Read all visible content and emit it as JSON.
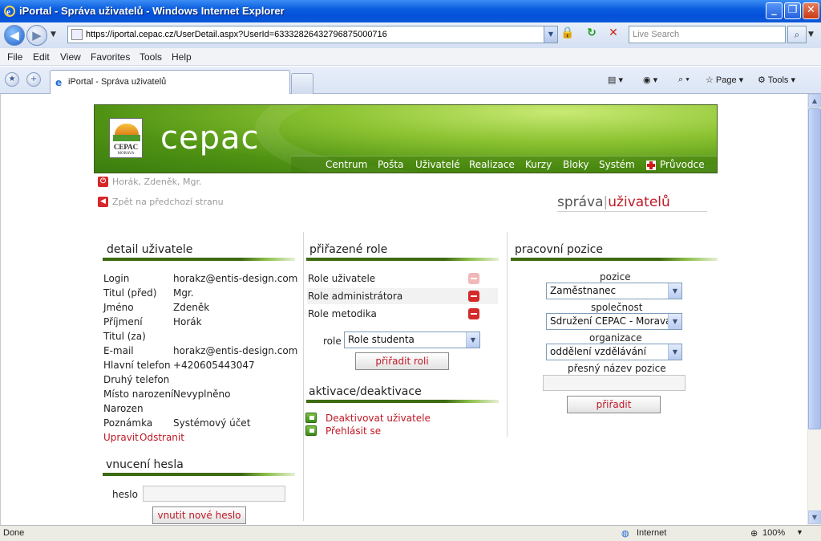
{
  "window": {
    "title": "iPortal - Správa uživatelů - Windows Internet Explorer"
  },
  "address": {
    "url": "https://iportal.cepac.cz/UserDetail.aspx?UserId=633328264327968750​00716",
    "search_placeholder": "Live Search"
  },
  "menu": [
    "File",
    "Edit",
    "View",
    "Favorites",
    "Tools",
    "Help"
  ],
  "tab": {
    "label": "iPortal - Správa uživatelů"
  },
  "commands": {
    "page": "Page",
    "tools": "Tools"
  },
  "status": {
    "text": "Done",
    "zone": "Internet",
    "zoom": "100%"
  },
  "site": {
    "brand": "cepac",
    "logo": {
      "line1": "CEPAC",
      "line2": "MORAVA"
    },
    "nav": [
      "Centrum",
      "Pošta",
      "Uživatelé",
      "Realizace",
      "Kurzy",
      "Bloky",
      "Systém",
      "Průvodce"
    ],
    "current_user": "Horák, Zdeněk, Mgr.",
    "back_link": "Zpět na předchozí stranu",
    "section": {
      "part1": "správa",
      "separator": "|",
      "part2": "uživatelů"
    }
  },
  "detail": {
    "title": "detail uživatele",
    "rows": [
      {
        "label": "Login",
        "value": "horakz@entis-design.com"
      },
      {
        "label": "Titul (před)",
        "value": "Mgr."
      },
      {
        "label": "Jméno",
        "value": "Zdeněk"
      },
      {
        "label": "Příjmení",
        "value": "Horák"
      },
      {
        "label": "Titul (za)",
        "value": ""
      },
      {
        "label": "E-mail",
        "value": "horakz@entis-design.com"
      },
      {
        "label": "Hlavní telefon",
        "value": "+420605443047"
      },
      {
        "label": "Druhý telefon",
        "value": ""
      },
      {
        "label": "Místo narození",
        "value": "Nevyplněno"
      },
      {
        "label": "Narozen",
        "value": ""
      },
      {
        "label": "Poznámka",
        "value": "Systémový účet"
      }
    ],
    "edit_link": "Upravit",
    "delete_link": "Odstranit"
  },
  "password": {
    "title": "vnucení hesla",
    "label": "heslo",
    "button": "vnutit nové heslo"
  },
  "roles": {
    "title": "přiřazené role",
    "items": [
      "Role uživatele",
      "Role administrátora",
      "Role metodika"
    ],
    "select_label": "role",
    "select_value": "Role studenta",
    "assign_button": "přiřadit roli"
  },
  "activation": {
    "title": "aktivace/deaktivace",
    "deactivate": "Deaktivovat uživatele",
    "login_as": "Přehlásit se"
  },
  "position": {
    "title": "pracovní pozice",
    "pozice_label": "pozice",
    "pozice_value": "Zaměstnanec",
    "spolecnost_label": "společnost",
    "spolecnost_value": "Sdružení CEPAC - Morava",
    "organizace_label": "organizace",
    "organizace_value": "oddělení vzdělávání",
    "name_label": "přesný název pozice",
    "assign_button": "přiřadit"
  }
}
